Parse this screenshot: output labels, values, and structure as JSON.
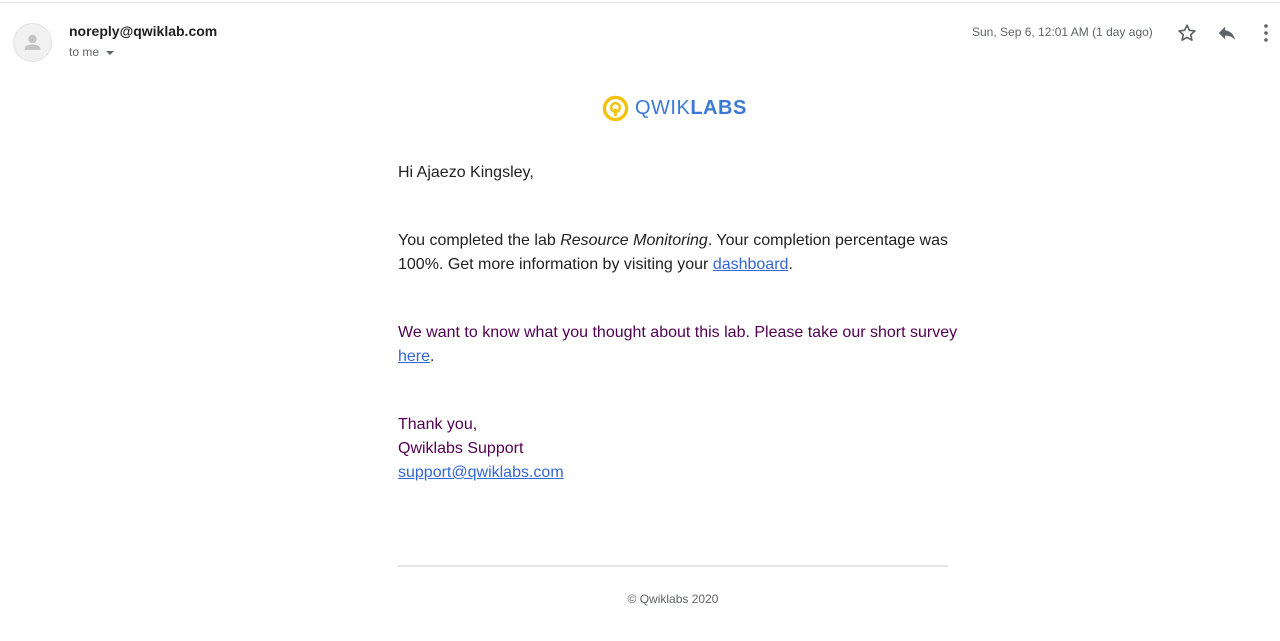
{
  "message": {
    "from": "noreply@qwiklab.com",
    "to_label": "to me",
    "date": "Sun, Sep 6, 12:01 AM (1 day ago)"
  },
  "icons": {
    "avatar": "person-icon",
    "star": "star-outline-icon",
    "reply": "reply-arrow-icon",
    "more": "more-vertical-icon",
    "logo": "qwiklabs-logo-icon"
  },
  "logo": {
    "part1": "QWIK",
    "part2": "LABS"
  },
  "body": {
    "greeting": "Hi Ajaezo Kingsley,",
    "completion_prefix": "You completed the lab ",
    "lab_name": "Resource Monitoring",
    "completion_suffix": ". Your completion percentage was 100%. Get more information by visiting your ",
    "dashboard_link": "dashboard",
    "period": ".",
    "survey_prefix": "We want to know what you thought about this lab. Please take our short survey ",
    "survey_link": "here",
    "survey_period": ".",
    "thanks": "Thank you,",
    "team": "Qwiklabs Support",
    "support_email": "support@qwiklabs.com"
  },
  "footer": {
    "copyright": "© Qwiklabs 2020"
  },
  "colors": {
    "brand_blue": "#3b79d6",
    "logo_yellow": "#f4c20d",
    "link": "#3367d6",
    "quoted_text": "#500050"
  }
}
